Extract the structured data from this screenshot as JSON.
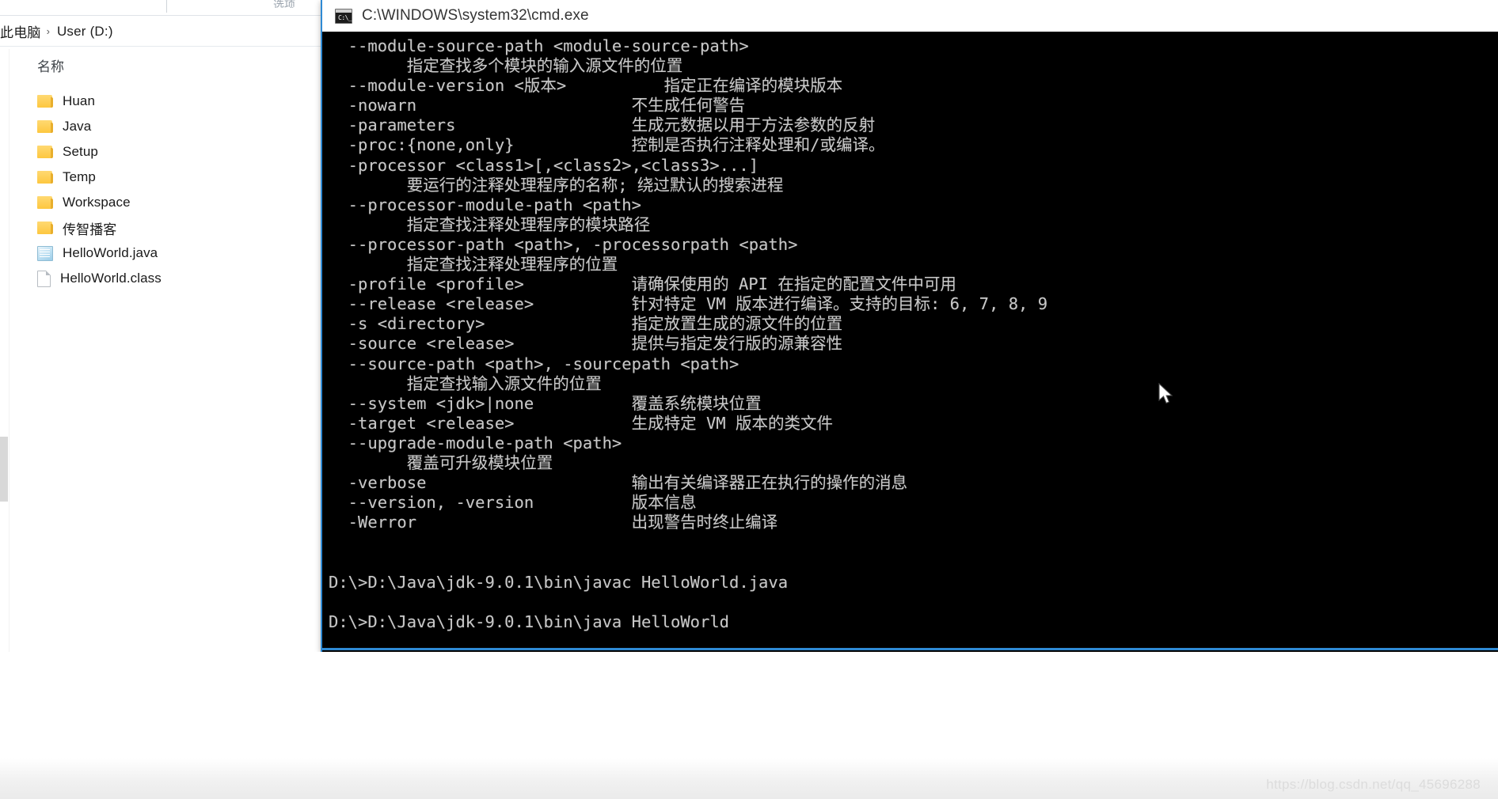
{
  "explorer": {
    "toolbar_partial_label": "选项",
    "breadcrumb": {
      "root": "此电脑",
      "separator": "›",
      "current": "User (D:)"
    },
    "column_header": "名称",
    "items": [
      {
        "name": "Huan",
        "type": "folder",
        "icon": "folder-icon"
      },
      {
        "name": "Java",
        "type": "folder",
        "icon": "folder-icon"
      },
      {
        "name": "Setup",
        "type": "folder",
        "icon": "folder-icon"
      },
      {
        "name": "Temp",
        "type": "folder",
        "icon": "folder-icon"
      },
      {
        "name": "Workspace",
        "type": "folder",
        "icon": "folder-icon"
      },
      {
        "name": "传智播客",
        "type": "folder",
        "icon": "folder-icon"
      },
      {
        "name": "HelloWorld.java",
        "type": "file",
        "icon": "java-source-file-icon"
      },
      {
        "name": "HelloWorld.class",
        "type": "file",
        "icon": "class-file-icon"
      }
    ]
  },
  "cmd": {
    "title": "C:\\WINDOWS\\system32\\cmd.exe",
    "icon": "cmd-console-icon",
    "prompt_glyph": "C:\\_",
    "output": "  --module-source-path <module-source-path>\n        指定查找多个模块的输入源文件的位置\n  --module-version <版本>          指定正在编译的模块版本\n  -nowarn                      不生成任何警告\n  -parameters                  生成元数据以用于方法参数的反射\n  -proc:{none,only}            控制是否执行注释处理和/或编译。\n  -processor <class1>[,<class2>,<class3>...]\n        要运行的注释处理程序的名称; 绕过默认的搜索进程\n  --processor-module-path <path>\n        指定查找注释处理程序的模块路径\n  --processor-path <path>, -processorpath <path>\n        指定查找注释处理程序的位置\n  -profile <profile>           请确保使用的 API 在指定的配置文件中可用\n  --release <release>          针对特定 VM 版本进行编译。支持的目标: 6, 7, 8, 9\n  -s <directory>               指定放置生成的源文件的位置\n  -source <release>            提供与指定发行版的源兼容性\n  --source-path <path>, -sourcepath <path>\n        指定查找输入源文件的位置\n  --system <jdk>|none          覆盖系统模块位置\n  -target <release>            生成特定 VM 版本的类文件\n  --upgrade-module-path <path>\n        覆盖可升级模块位置\n  -verbose                     输出有关编译器正在执行的操作的消息\n  --version, -version          版本信息\n  -Werror                      出现警告时终止编译\n\n\nD:\\>D:\\Java\\jdk-9.0.1\\bin\\javac HelloWorld.java\n\nD:\\>D:\\Java\\jdk-9.0.1\\bin\\java HelloWorld",
    "commands": [
      "D:\\>D:\\Java\\jdk-9.0.1\\bin\\javac HelloWorld.java",
      "D:\\>D:\\Java\\jdk-9.0.1\\bin\\java HelloWorld"
    ]
  },
  "watermark": "https://blog.csdn.net/qq_45696288",
  "colors": {
    "console_background": "#000000",
    "console_text": "#c8c8c8",
    "window_accent": "#2e8ad4",
    "folder_icon": "#fdc73f",
    "explorer_background": "#ffffff"
  }
}
